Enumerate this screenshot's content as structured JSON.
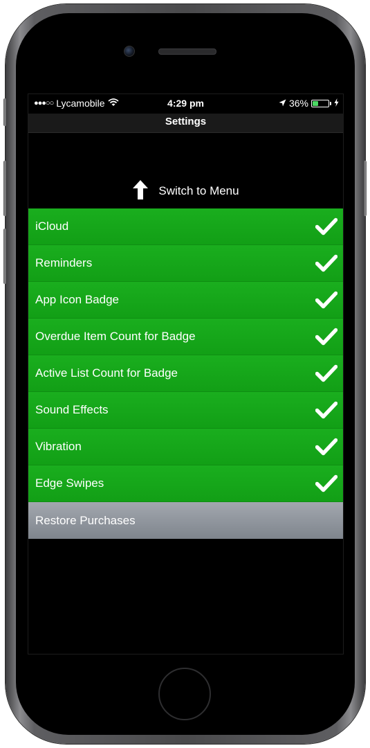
{
  "status_bar": {
    "signal": "●●●○○",
    "carrier": "Lycamobile",
    "wifi_icon": "wifi-icon",
    "time": "4:29 pm",
    "location_icon": "location-arrow-icon",
    "battery_percent": "36%",
    "battery_level": 0.36,
    "charging_icon": "charging-bolt-icon"
  },
  "nav_bar": {
    "title": "Settings"
  },
  "switch_menu": {
    "label": "Switch to Menu",
    "icon": "up-arrow-icon"
  },
  "settings": {
    "items": [
      {
        "label": "iCloud",
        "checked": true
      },
      {
        "label": "Reminders",
        "checked": true
      },
      {
        "label": "App Icon Badge",
        "checked": true
      },
      {
        "label": "Overdue Item Count for Badge",
        "checked": true
      },
      {
        "label": "Active List Count for Badge",
        "checked": true
      },
      {
        "label": "Sound Effects",
        "checked": true
      },
      {
        "label": "Vibration",
        "checked": true
      },
      {
        "label": "Edge Swipes",
        "checked": true
      }
    ],
    "restore_label": "Restore Purchases"
  },
  "colors": {
    "row_green": "#16a71a",
    "restore_gray": "#8f959c",
    "screen_background": "#000000"
  }
}
